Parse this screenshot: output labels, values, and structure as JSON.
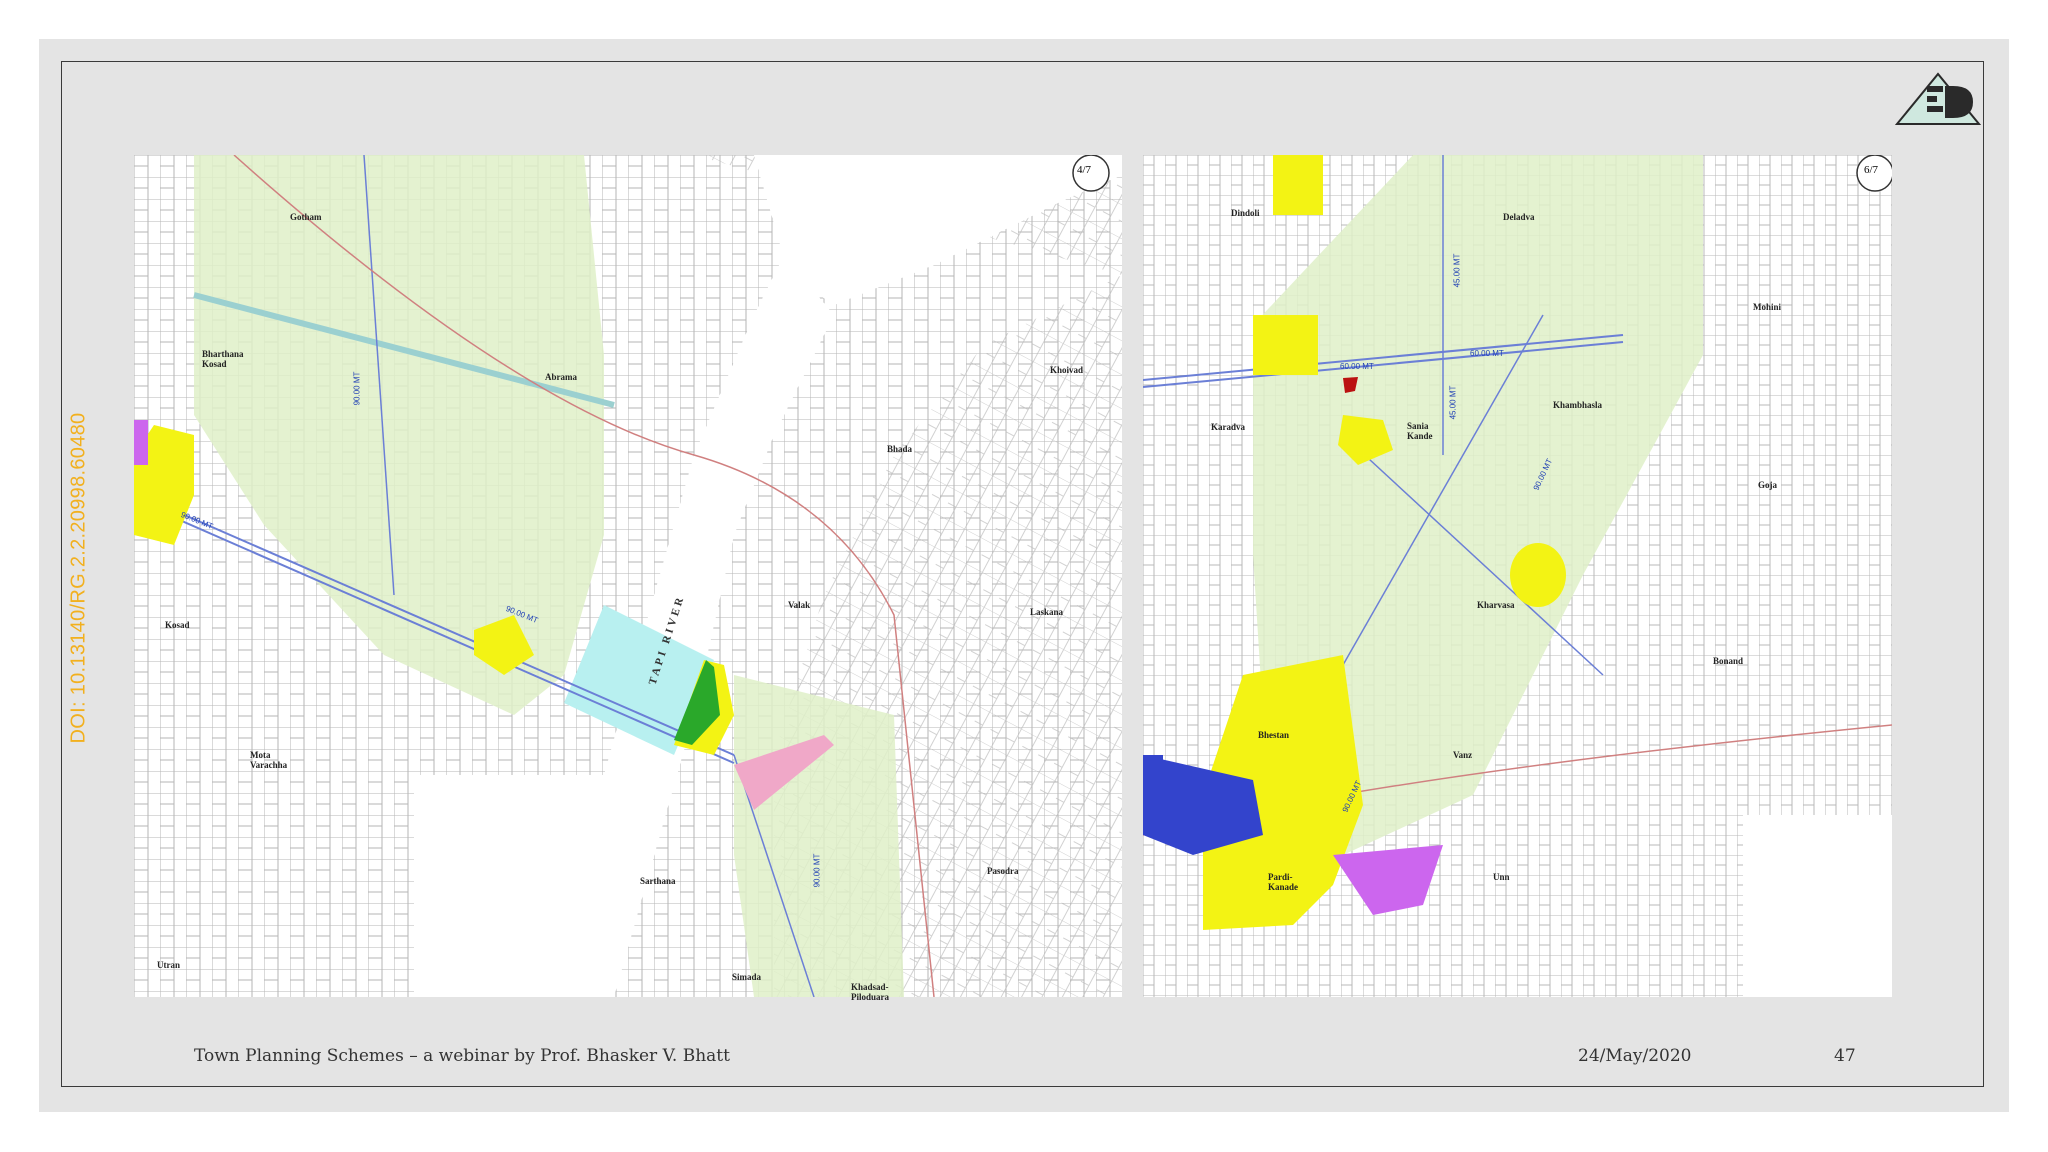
{
  "doi": "DOI: 10.13140/RG.2.2.20998.60480",
  "footer": {
    "title": "Town Planning Schemes – a webinar by Prof. Bhasker V. Bhatt",
    "date": "24/May/2020",
    "page": "47"
  },
  "left_map": {
    "sheet": "4/7",
    "river": "TAPI RIVER",
    "places": [
      "Gotham",
      "Bharthana Kosad",
      "Abrama",
      "Khoivad",
      "Bhada",
      "Kosad",
      "Valak",
      "Laskana",
      "Mota Varachha",
      "Sarthana",
      "Pasodra",
      "Utran",
      "Simada",
      "Khadsad-Piloduara"
    ],
    "roads": [
      "90.00 MT",
      "90.00 MT",
      "90.00 MT",
      "90.00 MT"
    ]
  },
  "right_map": {
    "sheet": "6/7",
    "places": [
      "Dindoli",
      "Deladva",
      "Mohini",
      "Karadva",
      "Sania Kande",
      "Kharvasa",
      "Khambhasla",
      "Goja",
      "Bhestan",
      "Unn",
      "Bonand",
      "Pardi-Kanade",
      "Vanz"
    ],
    "roads": [
      "60.00 MT",
      "60.00 MT",
      "45.00 MT",
      "45.00 MT",
      "90.00 MT",
      "90.00 MT"
    ]
  },
  "colors": {
    "green_belt": "#dff0c8",
    "residential": "#f3f314",
    "river_bridge": "#b8f0f0",
    "commercial": "#2aa82a",
    "industrial": "#cc66ee",
    "public": "#3344cc",
    "road_label": "#1f3fb5",
    "doi": "#f2b01e"
  },
  "icons": [
    "logo-icon",
    "north-arrow-icon"
  ]
}
